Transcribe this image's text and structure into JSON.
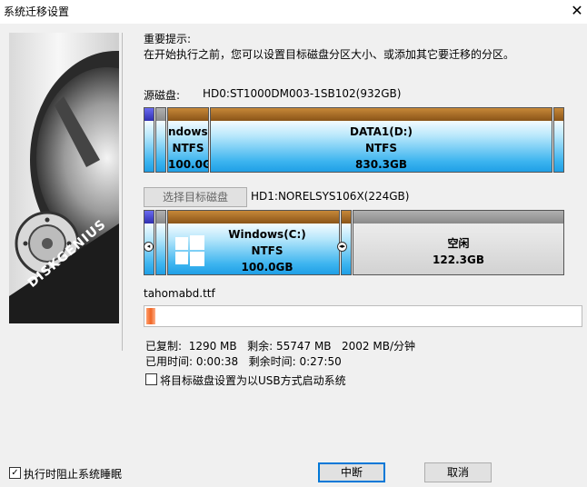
{
  "window": {
    "title": "系统迁移设置",
    "close_glyph": "✕"
  },
  "hint": {
    "title": "重要提示:",
    "text": "在开始执行之前，您可以设置目标磁盘分区大小、或添加其它要迁移的分区。"
  },
  "source": {
    "label": "源磁盘:",
    "disk": "HD0:ST1000DM003-1SB102(932GB)",
    "partitions": [
      {
        "name": "ndows(",
        "fs": "NTFS",
        "size": "100.0GB"
      },
      {
        "name": "DATA1(D:)",
        "fs": "NTFS",
        "size": "830.3GB"
      }
    ]
  },
  "target": {
    "select_button": "选择目标磁盘",
    "disk": "HD1:NORELSYS106X(224GB)",
    "partitions": [
      {
        "name": "Windows(C:)",
        "fs": "NTFS",
        "size": "100.0GB"
      },
      {
        "name": "空闲",
        "size": "122.3GB"
      }
    ]
  },
  "progress": {
    "current_file": "tahomabd.ttf",
    "percent": 2,
    "copied_label": "已复制:",
    "copied": "1290 MB",
    "remaining_label": "剩余:",
    "remaining": "55747 MB",
    "speed": "2002 MB/分钟",
    "elapsed_label": "已用时间:",
    "elapsed": "0:00:38",
    "time_left_label": "剩余时间:",
    "time_left": "0:27:50"
  },
  "options": {
    "usb_boot": {
      "label": "将目标磁盘设置为以USB方式启动系统",
      "checked": false
    },
    "prevent_sleep": {
      "label": "执行时阻止系统睡眠",
      "checked": true
    }
  },
  "buttons": {
    "abort": "中断",
    "cancel": "取消"
  },
  "brand": {
    "logo_text": "DISKGENIUS"
  }
}
